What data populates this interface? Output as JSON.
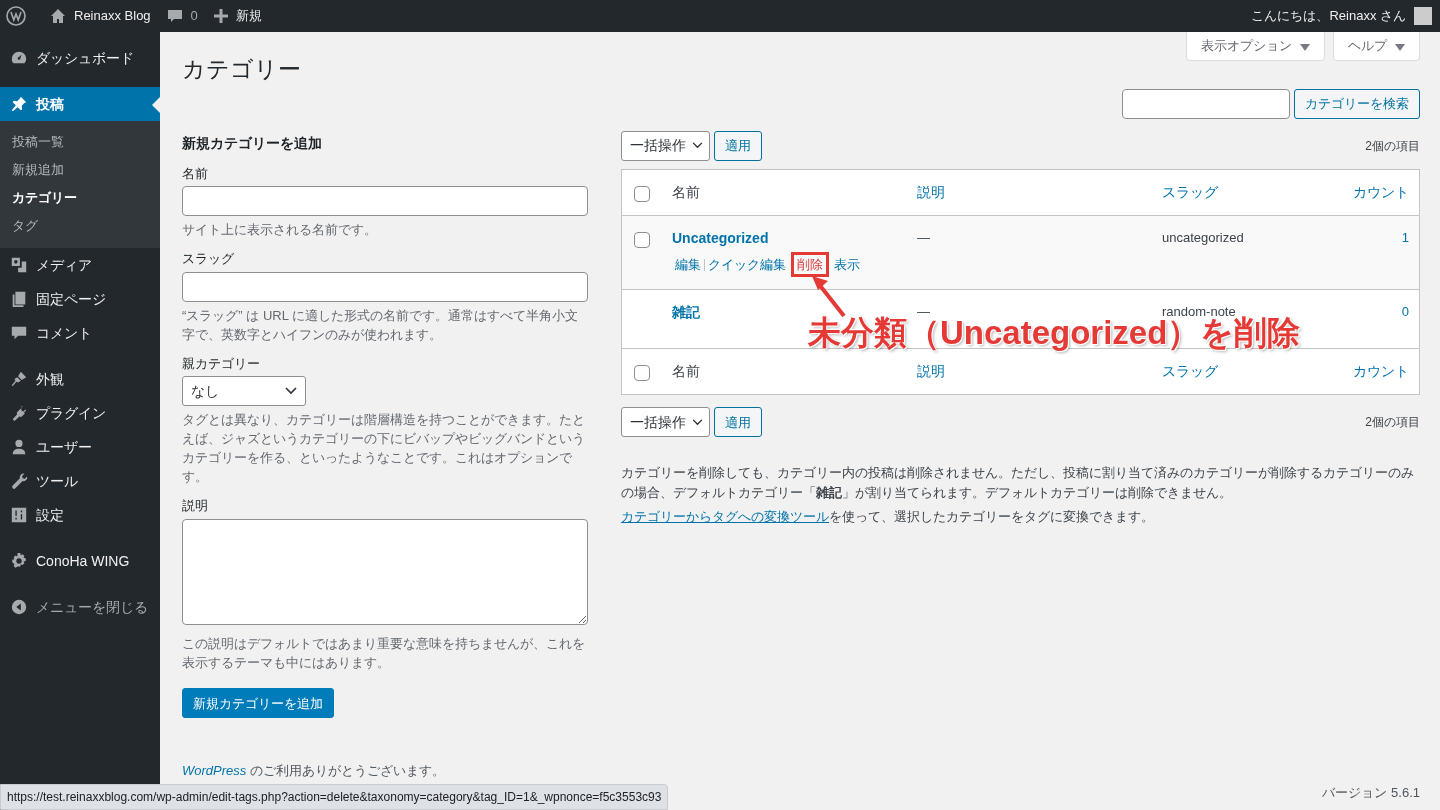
{
  "admin_bar": {
    "site": "Reinaxx Blog",
    "comments": "0",
    "new": "新規",
    "greeting": "こんにちは、Reinaxx さん"
  },
  "sidebar": {
    "groups": [
      [
        {
          "label": "ダッシュボード",
          "selected": false
        }
      ],
      [
        {
          "label": "投稿",
          "selected": true,
          "children": [
            {
              "label": "投稿一覧",
              "selected": false
            },
            {
              "label": "新規追加",
              "selected": false
            },
            {
              "label": "カテゴリー",
              "selected": true
            },
            {
              "label": "タグ",
              "selected": false
            }
          ]
        },
        {
          "label": "メディア",
          "selected": false
        },
        {
          "label": "固定ページ",
          "selected": false
        },
        {
          "label": "コメント",
          "selected": false
        }
      ],
      [
        {
          "label": "外観",
          "selected": false
        },
        {
          "label": "プラグイン",
          "selected": false
        },
        {
          "label": "ユーザー",
          "selected": false
        },
        {
          "label": "ツール",
          "selected": false
        },
        {
          "label": "設定",
          "selected": false
        }
      ],
      [
        {
          "label": "ConoHa WING",
          "selected": false
        }
      ]
    ],
    "collapse": "メニューを閉じる"
  },
  "screen_meta": [
    "表示オプション",
    "ヘルプ"
  ],
  "title": "カテゴリー",
  "search": {
    "button": "カテゴリーを検索"
  },
  "add_form": {
    "heading": "新規カテゴリーを追加",
    "fields": [
      {
        "kind": "text",
        "label": "名前",
        "help": "サイト上に表示される名前です。"
      },
      {
        "kind": "text",
        "label": "スラッグ",
        "help": "“スラッグ” は URL に適した形式の名前です。通常はすべて半角小文字で、英数字とハイフンのみが使われます。"
      },
      {
        "kind": "select",
        "label": "親カテゴリー",
        "value": "なし",
        "help": "タグとは異なり、カテゴリーは階層構造を持つことができます。たとえば、ジャズというカテゴリーの下にビバップやビッグバンドというカテゴリーを作る、といったようなことです。これはオプションです。"
      },
      {
        "kind": "textarea",
        "label": "説明",
        "help": "この説明はデフォルトではあまり重要な意味を持ちませんが、これを表示するテーマも中にはあります。"
      }
    ],
    "submit": "新規カテゴリーを追加"
  },
  "table": {
    "bulk_top": {
      "select": "一括操作",
      "apply": "適用",
      "count": "2個の項目"
    },
    "columns": [
      "名前",
      "説明",
      "スラッグ",
      "カウント"
    ],
    "header_checked": false,
    "rows": [
      {
        "name": "Uncategorized",
        "description": "—",
        "slug": "uncategorized",
        "count": "1",
        "has_checkbox": true,
        "checked": false,
        "actions": [
          {
            "label": "編集",
            "highlighted": false
          },
          {
            "label": "クイック編集",
            "highlighted": false
          },
          {
            "label": "削除",
            "highlighted": true
          },
          {
            "label": "表示",
            "highlighted": false
          }
        ]
      },
      {
        "name": "雑記",
        "description": "—",
        "slug": "random-note",
        "count": "0",
        "has_checkbox": false,
        "actions": []
      }
    ],
    "footer_columns": [
      "名前",
      "説明",
      "スラッグ",
      "カウント"
    ],
    "footer_checked": false,
    "bulk_bottom": {
      "select": "一括操作",
      "apply": "適用",
      "count": "2個の項目"
    }
  },
  "annotation": "未分類（Uncategorized）を削除",
  "notes": {
    "paragraph": "カテゴリーを削除しても、カテゴリー内の投稿は削除されません。ただし、投稿に割り当て済みのカテゴリーが削除するカテゴリーのみの場合、デフォルトカテゴリー「**雑記**」が割り当てられます。デフォルトカテゴリーは削除できません。",
    "link": "カテゴリーからタグへの変換ツール",
    "link_rest": "を使って、選択したカテゴリーをタグに変換できます。"
  },
  "footer": {
    "link": "WordPress",
    "thanks": "のご利用ありがとうございます。",
    "version": "バージョン 5.6.1"
  },
  "status_url": "https://test.reinaxxblog.com/wp-admin/edit-tags.php?action=delete&taxonomy=category&tag_ID=1&_wpnonce=f5c3553c93"
}
